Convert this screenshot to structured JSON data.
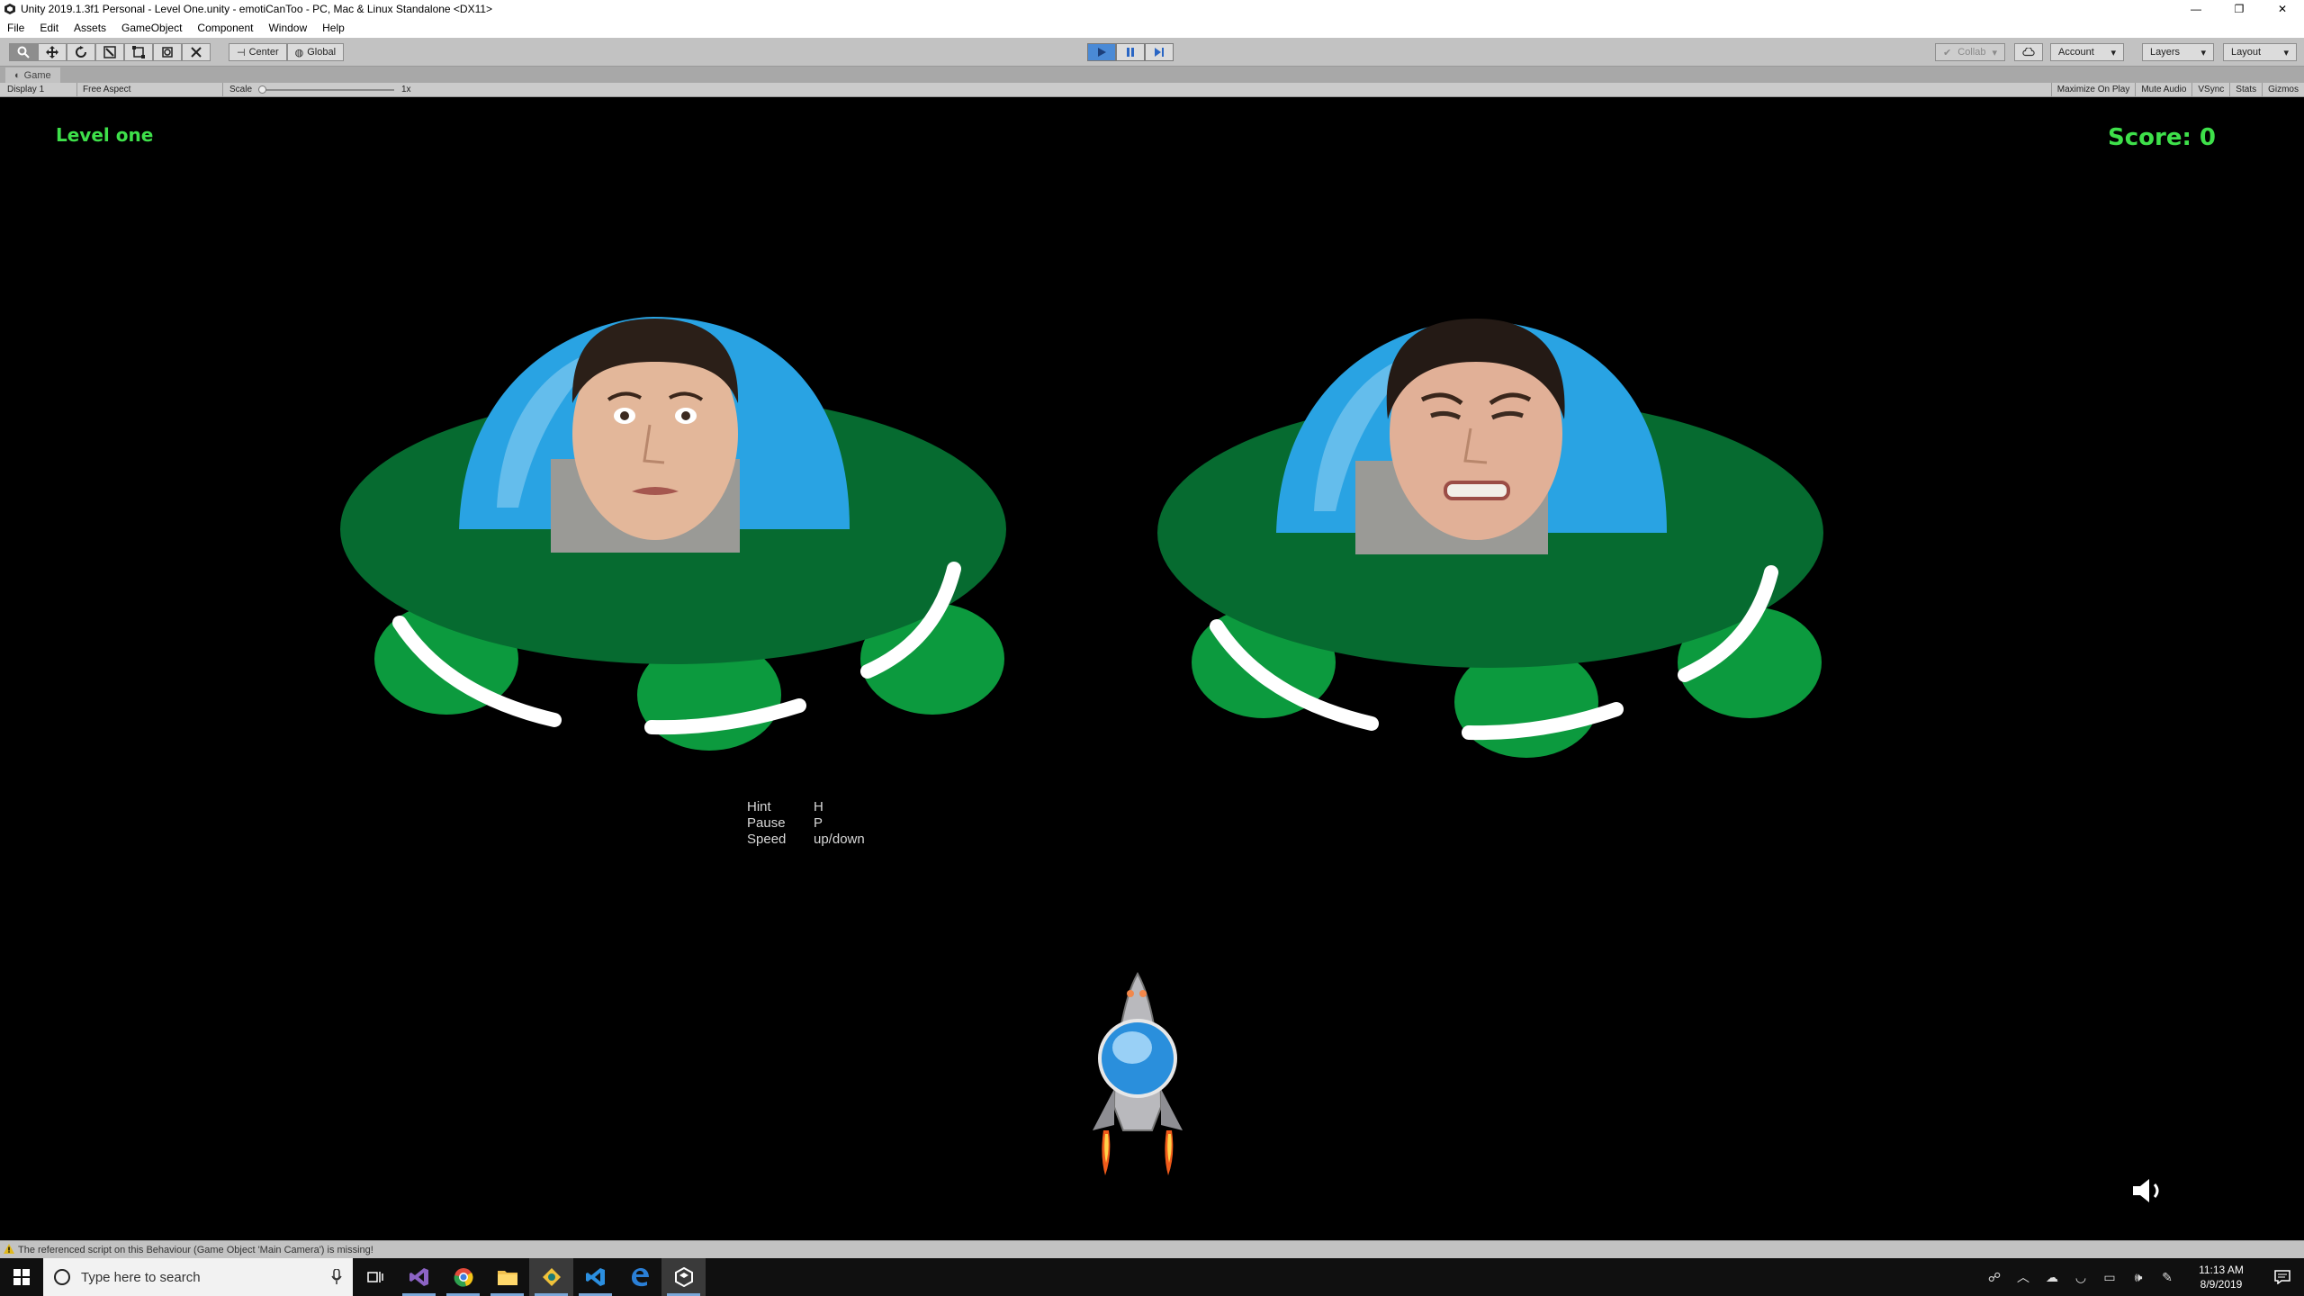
{
  "window": {
    "title": "Unity 2019.1.3f1 Personal - Level One.unity - emotiCanToo - PC, Mac & Linux Standalone <DX11>",
    "controls": [
      "—",
      "❐",
      "✕"
    ]
  },
  "menu": [
    "File",
    "Edit",
    "Assets",
    "GameObject",
    "Component",
    "Window",
    "Help"
  ],
  "toolbar": {
    "pivot_label": "Center",
    "space_label": "Global",
    "collab_label": "Collab",
    "account_label": "Account",
    "layers_label": "Layers",
    "layout_label": "Layout"
  },
  "game_tab": {
    "label": "Game"
  },
  "game_toolbar": {
    "display": "Display 1",
    "aspect": "Free Aspect",
    "scale_label": "Scale",
    "scale_value": "1x",
    "toggles": [
      "Maximize On Play",
      "Mute Audio",
      "VSync",
      "Stats",
      "Gizmos"
    ]
  },
  "game": {
    "level_label": "Level one",
    "score_label": "Score: 0",
    "hints": [
      {
        "label": "Hint",
        "key": "H"
      },
      {
        "label": "Pause",
        "key": "P"
      },
      {
        "label": "Speed",
        "key": "up/down"
      }
    ],
    "colors": {
      "hud_green": "#3ee04a",
      "ufo_dark": "#066b30",
      "ufo_light": "#0c9a3e",
      "dome": "#29a3e3"
    }
  },
  "status": {
    "message": "The referenced script on this Behaviour (Game Object 'Main Camera') is missing!"
  },
  "taskbar": {
    "search_placeholder": "Type here to search",
    "apps": [
      "task-view-icon",
      "visual-studio-icon",
      "chrome-icon",
      "file-explorer-icon",
      "git-kraken-icon",
      "vscode-icon",
      "edge-icon",
      "unity-icon"
    ],
    "time": "11:13 AM",
    "date": "8/9/2019"
  }
}
